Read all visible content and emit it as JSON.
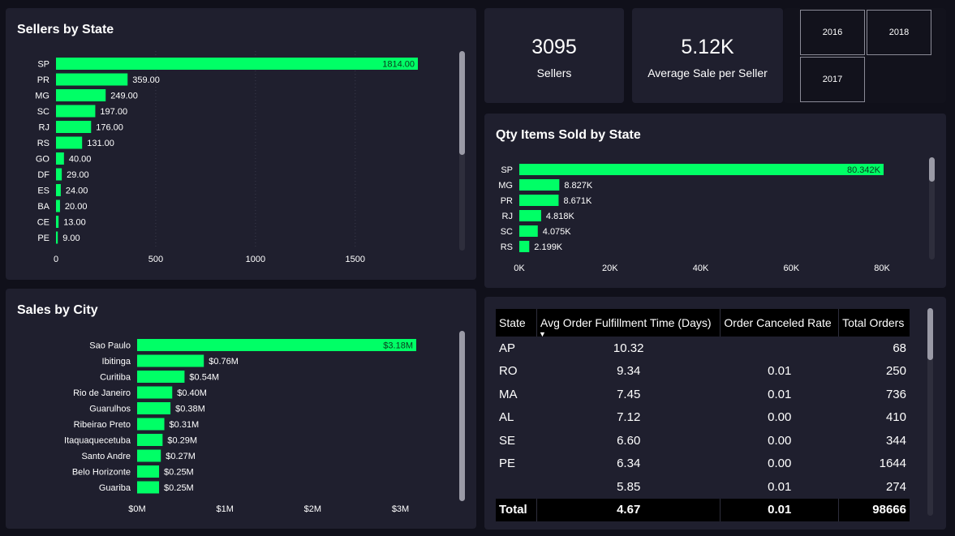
{
  "colors": {
    "bar": "#00ff66",
    "panel": "#1f1f2e",
    "background": "#10101a",
    "text": "#ffffff"
  },
  "sellers_by_state": {
    "title": "Sellers by State",
    "chart_data": {
      "type": "bar",
      "orientation": "horizontal",
      "categories": [
        "SP",
        "PR",
        "MG",
        "SC",
        "RJ",
        "RS",
        "GO",
        "DF",
        "ES",
        "BA",
        "CE",
        "PE"
      ],
      "values": [
        1814,
        359,
        249,
        197,
        176,
        131,
        40,
        29,
        24,
        20,
        13,
        9
      ],
      "value_labels": [
        "1814.00",
        "359.00",
        "249.00",
        "197.00",
        "176.00",
        "131.00",
        "40.00",
        "29.00",
        "24.00",
        "20.00",
        "13.00",
        "9.00"
      ],
      "xticks": [
        0,
        500,
        1000,
        1500
      ],
      "xtick_labels": [
        "0",
        "500",
        "1000",
        "1500"
      ],
      "xlim": [
        0,
        1814
      ],
      "grid": true
    }
  },
  "sales_by_city": {
    "title": "Sales by City",
    "chart_data": {
      "type": "bar",
      "orientation": "horizontal",
      "categories": [
        "Sao Paulo",
        "Ibitinga",
        "Curitiba",
        "Rio de Janeiro",
        "Guarulhos",
        "Ribeirao Preto",
        "Itaquaquecetuba",
        "Santo Andre",
        "Belo Horizonte",
        "Guariba"
      ],
      "values": [
        3.18,
        0.76,
        0.54,
        0.4,
        0.38,
        0.31,
        0.29,
        0.27,
        0.25,
        0.25
      ],
      "value_labels": [
        "$3.18M",
        "$0.76M",
        "$0.54M",
        "$0.40M",
        "$0.38M",
        "$0.31M",
        "$0.29M",
        "$0.27M",
        "$0.25M",
        "$0.25M"
      ],
      "xticks": [
        0,
        1,
        2,
        3
      ],
      "xtick_labels": [
        "$0M",
        "$1M",
        "$2M",
        "$3M"
      ],
      "xlim": [
        0,
        3.18
      ],
      "unit": "M"
    }
  },
  "kpis": [
    {
      "value": "3095",
      "label": "Sellers"
    },
    {
      "value": "5.12K",
      "label": "Average Sale per Seller"
    }
  ],
  "year_tiles": [
    "2016",
    "2018",
    "2017"
  ],
  "qty_items_by_state": {
    "title": "Qty Items Sold by State",
    "chart_data": {
      "type": "bar",
      "orientation": "horizontal",
      "categories": [
        "SP",
        "MG",
        "PR",
        "RJ",
        "SC",
        "RS"
      ],
      "values": [
        80342,
        8827,
        8671,
        4818,
        4075,
        2199
      ],
      "value_labels": [
        "80.342K",
        "8.827K",
        "8.671K",
        "4.818K",
        "4.075K",
        "2.199K"
      ],
      "xticks": [
        0,
        20000,
        40000,
        60000,
        80000
      ],
      "xtick_labels": [
        "0K",
        "20K",
        "40K",
        "60K",
        "80K"
      ],
      "xlim": [
        0,
        80342
      ]
    }
  },
  "table": {
    "columns": [
      "State",
      "Avg Order Fulfillment Time (Days)",
      "Order Canceled Rate",
      "Total Orders"
    ],
    "sort_indicator": "▼",
    "rows": [
      [
        "AP",
        "10.32",
        "",
        "68"
      ],
      [
        "RO",
        "9.34",
        "0.01",
        "250"
      ],
      [
        "MA",
        "7.45",
        "0.01",
        "736"
      ],
      [
        "AL",
        "7.12",
        "0.00",
        "410"
      ],
      [
        "SE",
        "6.60",
        "0.00",
        "344"
      ],
      [
        "PE",
        "6.34",
        "0.00",
        "1644"
      ],
      [
        "",
        "5.85",
        "0.01",
        "274"
      ]
    ],
    "total": [
      "Total",
      "4.67",
      "0.01",
      "98666"
    ]
  }
}
